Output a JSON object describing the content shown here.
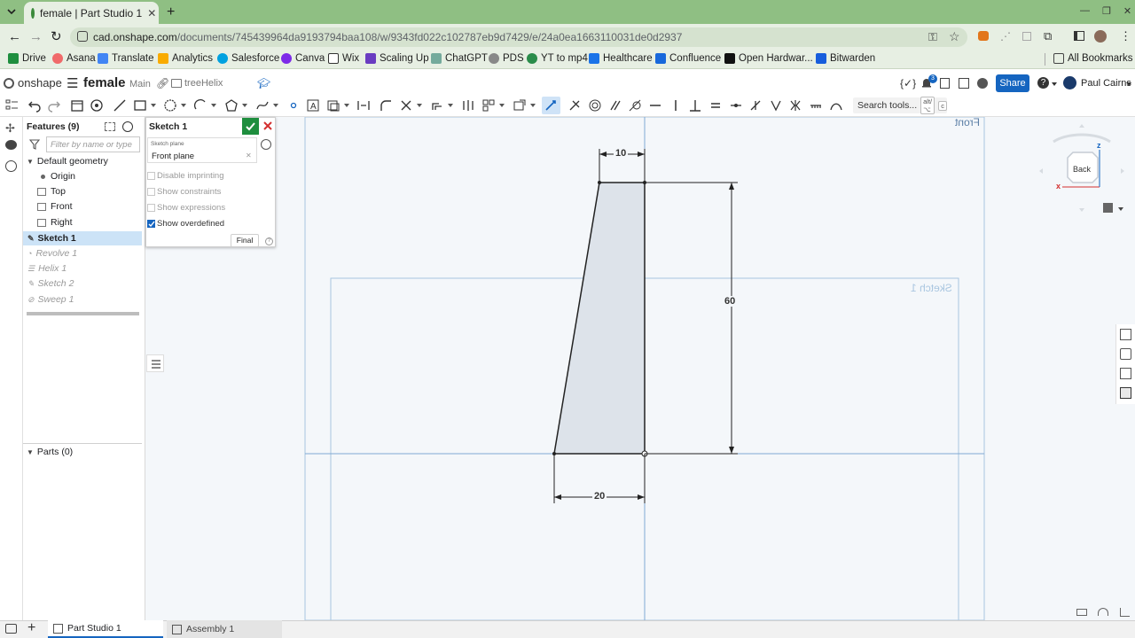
{
  "browser": {
    "tab_title": "female | Part Studio 1",
    "url_host": "cad.onshape.com",
    "url_path": "/documents/745439964da9193794baa108/w/9343fd022c102787eb9d7429/e/24a0ea1663110031de0d2937",
    "bookmarks": [
      {
        "label": "Drive",
        "color": "#1e8e3e"
      },
      {
        "label": "Asana",
        "color": "#f06a6a"
      },
      {
        "label": "Translate",
        "color": "#4285f4"
      },
      {
        "label": "Analytics",
        "color": "#f9ab00"
      },
      {
        "label": "Salesforce",
        "color": "#00a1e0"
      },
      {
        "label": "Canva",
        "color": "#7d2ae8"
      },
      {
        "label": "Wix",
        "color": "#333333"
      },
      {
        "label": "Scaling Up",
        "color": "#6a3cc1"
      },
      {
        "label": "ChatGPT",
        "color": "#74aa9c"
      },
      {
        "label": "PDS",
        "color": "#888888"
      },
      {
        "label": "YT to mp4",
        "color": "#2a8c4a"
      },
      {
        "label": "Healthcare",
        "color": "#1a73e8"
      },
      {
        "label": "Confluence",
        "color": "#1868db"
      },
      {
        "label": "Open Hardwar...",
        "color": "#111111"
      },
      {
        "label": "Bitwarden",
        "color": "#175ddc"
      }
    ],
    "all_bookmarks": "All Bookmarks"
  },
  "app": {
    "logo": "onshape",
    "doc_name": "female",
    "branch": "Main",
    "folder": "treeHelix",
    "notification_count": "3",
    "share_label": "Share",
    "user_name": "Paul Cairns",
    "search_tools": "Search tools...",
    "search_shortcut_key": "alt/⌥",
    "search_shortcut_letter": "c"
  },
  "features": {
    "header": "Features (9)",
    "filter_placeholder": "Filter by name or type",
    "default_geometry": "Default geometry",
    "origin": "Origin",
    "top": "Top",
    "front": "Front",
    "right": "Right",
    "sketch1": "Sketch 1",
    "revolve1": "Revolve 1",
    "helix1": "Helix 1",
    "sketch2": "Sketch 2",
    "sweep1": "Sweep 1",
    "parts": "Parts (0)"
  },
  "sketch_dialog": {
    "title": "Sketch 1",
    "plane_label": "Sketch plane",
    "plane_value": "Front plane",
    "disable_imprinting": "Disable imprinting",
    "show_constraints": "Show constraints",
    "show_expressions": "Show expressions",
    "show_overdefined": "Show overdefined",
    "show_overdefined_checked": true,
    "final_button": "Final"
  },
  "canvas": {
    "front_label": "Front",
    "sketch_label": "Sketch 1",
    "view_cube_label": "Back",
    "axis_z": "z",
    "axis_x": "x",
    "dim_top": "10",
    "dim_height": "60",
    "dim_bottom": "20"
  },
  "bottom_tabs": {
    "part_studio": "Part Studio 1",
    "assembly": "Assembly 1"
  },
  "colors": {
    "accent": "#1565c0",
    "tab_green": "#8fbf83",
    "confirm_green": "#1e8e3e",
    "cancel_red": "#d32f2f",
    "sketch_fill": "#dde3ea"
  }
}
